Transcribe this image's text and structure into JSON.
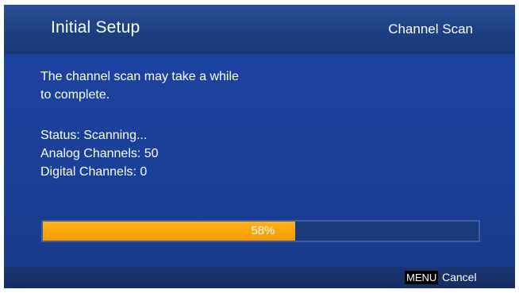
{
  "header": {
    "title": "Initial Setup",
    "context": "Channel Scan"
  },
  "content": {
    "message_line1": "The channel scan may take a while",
    "message_line2": "to complete.",
    "status": "Status: Scanning...",
    "analog_channels": "Analog Channels: 50",
    "digital_channels": "Digital Channels: 0"
  },
  "progress": {
    "value_percent": 58,
    "label": "58%"
  },
  "footer": {
    "key_label": "MENU",
    "action_label": "Cancel"
  },
  "colors": {
    "background": "#1a3f97",
    "progress_fill": "#f7a30a",
    "progress_track": "#1b3a7a"
  }
}
